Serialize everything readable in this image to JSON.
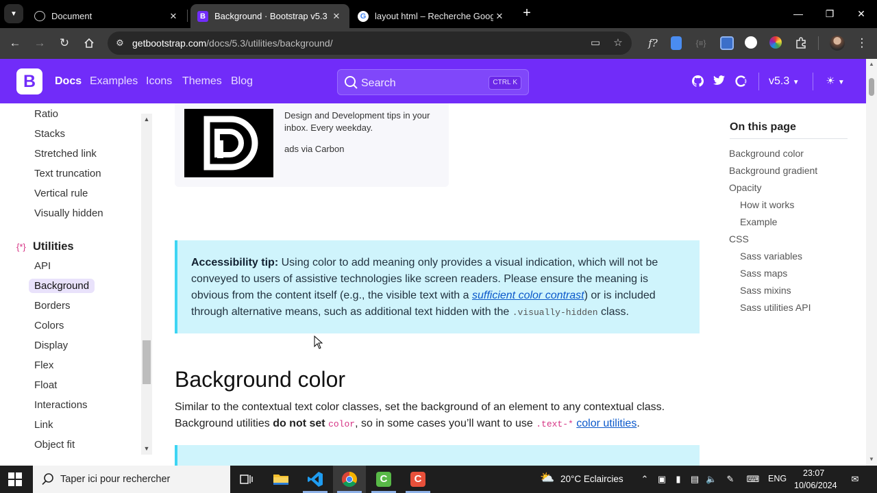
{
  "browser": {
    "tabs": [
      {
        "title": "Document",
        "favicon": "globe-icon",
        "active": false
      },
      {
        "title": "Background · Bootstrap v5.3",
        "favicon": "bootstrap-icon",
        "active": true
      },
      {
        "title": "layout html – Recherche Googl",
        "favicon": "google-icon",
        "active": false
      }
    ],
    "url_host": "getbootstrap.com",
    "url_path": "/docs/5.3/utilities/background/"
  },
  "navbar": {
    "logo": "B",
    "links": [
      "Docs",
      "Examples",
      "Icons",
      "Themes",
      "Blog"
    ],
    "search_placeholder": "Search",
    "shortcut_ctrl": "CTRL",
    "shortcut_key": "K",
    "version": "v5.3"
  },
  "sidebar": {
    "items_top": [
      "Ratio",
      "Stacks",
      "Stretched link",
      "Text truncation",
      "Vertical rule",
      "Visually hidden"
    ],
    "section_title": "Utilities",
    "section_items": [
      "API",
      "Background",
      "Borders",
      "Colors",
      "Display",
      "Flex",
      "Float",
      "Interactions",
      "Link",
      "Object fit"
    ],
    "active_item": "Background"
  },
  "ad": {
    "text": "Design and Development tips in your inbox. Every weekday.",
    "via": "ads via Carbon"
  },
  "callout": {
    "strong": "Accessibility tip:",
    "text_1": " Using color to add meaning only provides a visual indication, which will not be conveyed to users of assistive technologies like screen readers. Please ensure the meaning is obvious from the content itself (e.g., the visible text with a ",
    "link": "sufficient color contrast",
    "text_2": ") or is included through alternative means, such as additional text hidden with the ",
    "code": ".visually-hidden",
    "text_3": " class."
  },
  "section": {
    "heading": "Background color",
    "lead_1": "Similar to the contextual text color classes, set the background of an element to any contextual class. Background utilities ",
    "lead_bold": "do not set",
    "lead_code1": "color",
    "lead_2": ", so in some cases you’ll want to use ",
    "lead_code2": ".text-*",
    "lead_link": "color utilities",
    "lead_3": "."
  },
  "toc": {
    "title": "On this page",
    "items": [
      {
        "label": "Background color",
        "level": 1
      },
      {
        "label": "Background gradient",
        "level": 1
      },
      {
        "label": "Opacity",
        "level": 1
      },
      {
        "label": "How it works",
        "level": 2
      },
      {
        "label": "Example",
        "level": 2
      },
      {
        "label": "CSS",
        "level": 1
      },
      {
        "label": "Sass variables",
        "level": 2
      },
      {
        "label": "Sass maps",
        "level": 2
      },
      {
        "label": "Sass mixins",
        "level": 2
      },
      {
        "label": "Sass utilities API",
        "level": 2
      }
    ]
  },
  "taskbar": {
    "search_placeholder": "Taper ici pour rechercher",
    "weather": "20°C  Eclaircies",
    "language": "ENG",
    "time": "23:07",
    "date": "10/06/2024"
  },
  "colors": {
    "bootstrap_purple": "#712cf9",
    "callout_bg": "#cff4fc",
    "callout_border": "#3dd5f3",
    "link": "#0a58ca",
    "code_pink": "#d63384"
  }
}
